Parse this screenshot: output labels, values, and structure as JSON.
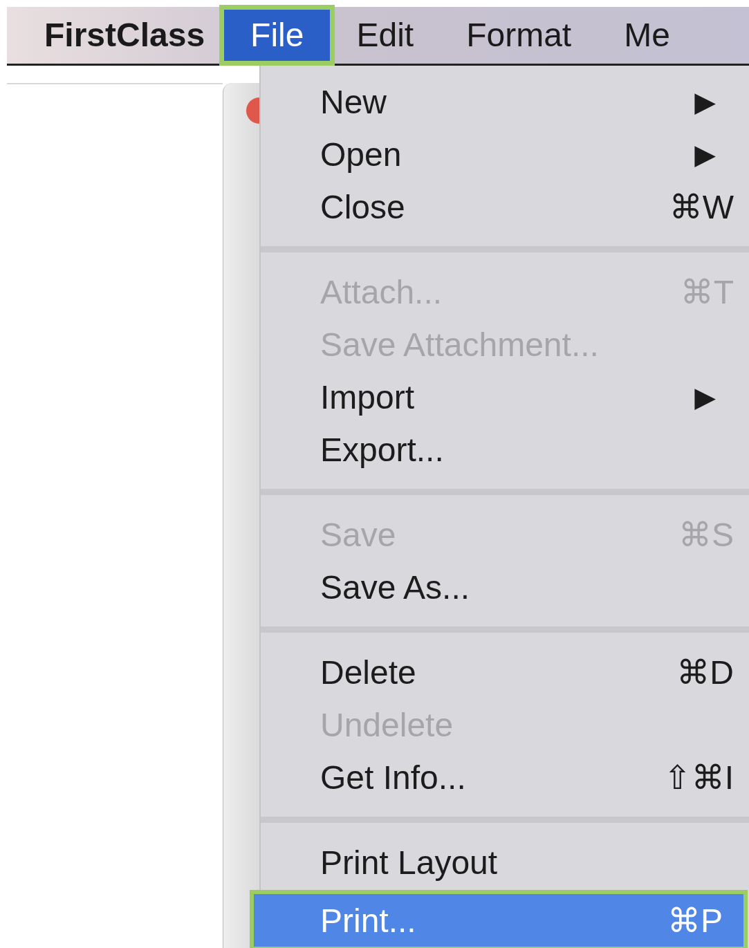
{
  "menu_bar": [
    {
      "label": "FirstClass",
      "kind": "app"
    },
    {
      "label": "File",
      "kind": "menu",
      "selected": true
    },
    {
      "label": "Edit",
      "kind": "menu",
      "selected": false
    },
    {
      "label": "Format",
      "kind": "menu",
      "selected": false
    },
    {
      "label": "Me",
      "kind": "menu",
      "selected": false
    }
  ],
  "file_menu": [
    {
      "kind": "item",
      "label": "New",
      "submenu": "▶",
      "disabled": false,
      "selected": false
    },
    {
      "kind": "item",
      "label": "Open",
      "submenu": "▶",
      "disabled": false,
      "selected": false
    },
    {
      "kind": "item",
      "label": "Close",
      "shortcut": "⌘W",
      "disabled": false,
      "selected": false
    },
    {
      "kind": "separator"
    },
    {
      "kind": "item",
      "label": "Attach...",
      "shortcut": "⌘T",
      "disabled": true,
      "selected": false
    },
    {
      "kind": "item",
      "label": "Save Attachment...",
      "disabled": true,
      "selected": false
    },
    {
      "kind": "item",
      "label": "Import",
      "submenu": "▶",
      "disabled": false,
      "selected": false
    },
    {
      "kind": "item",
      "label": "Export...",
      "disabled": false,
      "selected": false
    },
    {
      "kind": "separator"
    },
    {
      "kind": "item",
      "label": "Save",
      "shortcut": "⌘S",
      "disabled": true,
      "selected": false
    },
    {
      "kind": "item",
      "label": "Save As...",
      "disabled": false,
      "selected": false
    },
    {
      "kind": "separator"
    },
    {
      "kind": "item",
      "label": "Delete",
      "shortcut": "⌘D",
      "disabled": false,
      "selected": false
    },
    {
      "kind": "item",
      "label": "Undelete",
      "disabled": true,
      "selected": false
    },
    {
      "kind": "item",
      "label": "Get Info...",
      "shortcut": "⇧⌘I",
      "disabled": false,
      "selected": false
    },
    {
      "kind": "separator"
    },
    {
      "kind": "item",
      "label": "Print Layout",
      "disabled": false,
      "selected": false
    },
    {
      "kind": "item",
      "label": "Print...",
      "shortcut": "⌘P",
      "disabled": false,
      "selected": true
    }
  ]
}
